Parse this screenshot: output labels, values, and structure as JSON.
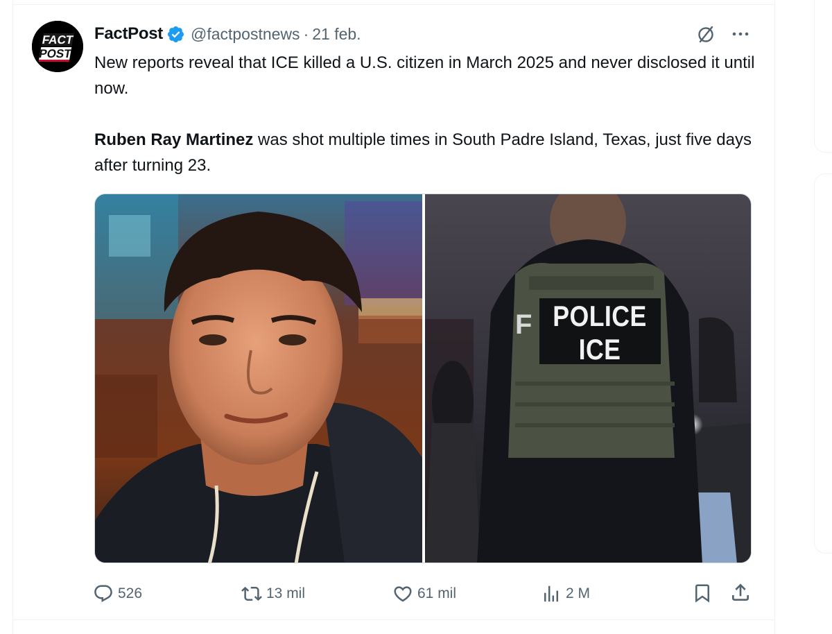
{
  "tweet": {
    "author": {
      "display_name": "FactPost",
      "handle": "@factpostnews",
      "separator": "·",
      "date": "21 feb.",
      "avatar_text_line1": "FACT",
      "avatar_text_line2": "POST"
    },
    "text": {
      "paragraph1": "New reports reveal that ICE killed a U.S. citizen in March 2025 and never disclosed it until now.",
      "paragraph2_bold": "Ruben Ray Martinez",
      "paragraph2_rest": " was shot multiple times in South Padre Island, Texas, just five days after turning 23."
    },
    "media": {
      "image_right_vest_line1": "POLICE",
      "image_right_vest_line2": "ICE",
      "image_right_vest_partial": "F"
    },
    "actions": {
      "replies": "526",
      "reposts": "13 mil",
      "likes": "61 mil",
      "views": "2 M"
    }
  },
  "icons": {
    "verified": "verified-badge-icon",
    "grok": "grok-icon",
    "more": "more-icon",
    "reply": "reply-icon",
    "repost": "repost-icon",
    "like": "heart-icon",
    "views": "views-chart-icon",
    "bookmark": "bookmark-icon",
    "share": "share-icon"
  },
  "colors": {
    "verified_blue": "#1d9bf0",
    "secondary_text": "#536471",
    "primary_text": "#0f1419"
  }
}
